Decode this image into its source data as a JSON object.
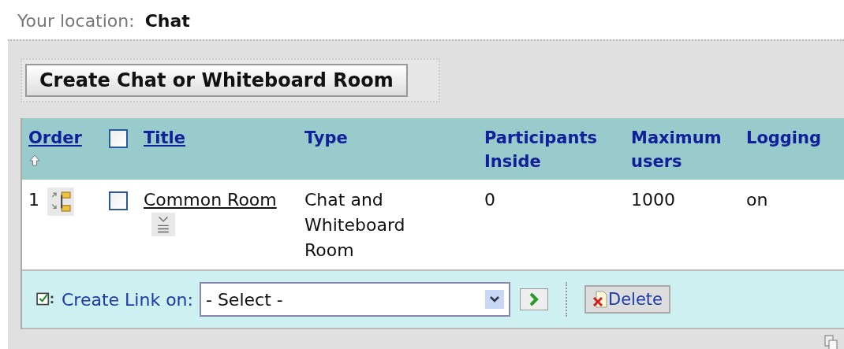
{
  "location": {
    "label": "Your location:",
    "value": "Chat"
  },
  "create_button": "Create Chat or Whiteboard Room",
  "table": {
    "columns": [
      {
        "label": "Order",
        "link": true,
        "sort_ascending": true
      },
      {
        "kind": "checkbox",
        "checked": false
      },
      {
        "label": "Title",
        "link": true
      },
      {
        "label": "Type",
        "link": false
      },
      {
        "label": "Participants Inside",
        "link": false
      },
      {
        "label": "Maximum users",
        "link": false
      },
      {
        "label": "Logging",
        "link": false
      }
    ],
    "rows": [
      {
        "order": "1",
        "checked": false,
        "title": "Common Room",
        "type": "Chat and Whiteboard Room",
        "participants": "0",
        "max_users": "1000",
        "logging": "on"
      }
    ]
  },
  "actions": {
    "label": "Create Link on:",
    "select": "- Select -",
    "delete": "Delete"
  }
}
